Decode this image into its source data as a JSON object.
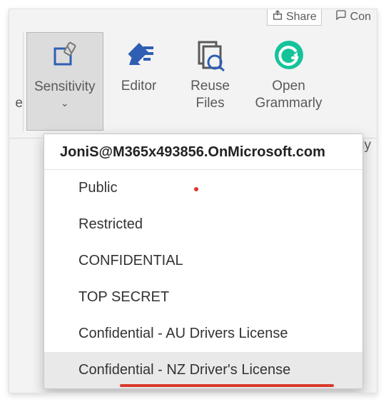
{
  "top": {
    "share_label": "Share",
    "comment_partial": "Con"
  },
  "ribbon": {
    "sensitivity": {
      "label": "Sensitivity"
    },
    "editor": {
      "label": "Editor"
    },
    "reuse": {
      "line1": "Reuse",
      "line2": "Files"
    },
    "grammarly": {
      "line1": "Open",
      "line2": "Grammarly"
    },
    "cut_left_char": "e",
    "cut_right_suffix": "rly"
  },
  "dropdown": {
    "account": "JoniS@M365x493856.OnMicrosoft.com",
    "items": [
      "Public",
      "Restricted",
      "CONFIDENTIAL",
      "TOP SECRET",
      "Confidential - AU Drivers License",
      "Confidential - NZ Driver's License"
    ]
  },
  "colors": {
    "accent_blue": "#2f5fb3",
    "grammarly_green": "#15c39a",
    "highlight_red": "#d93a2b"
  }
}
